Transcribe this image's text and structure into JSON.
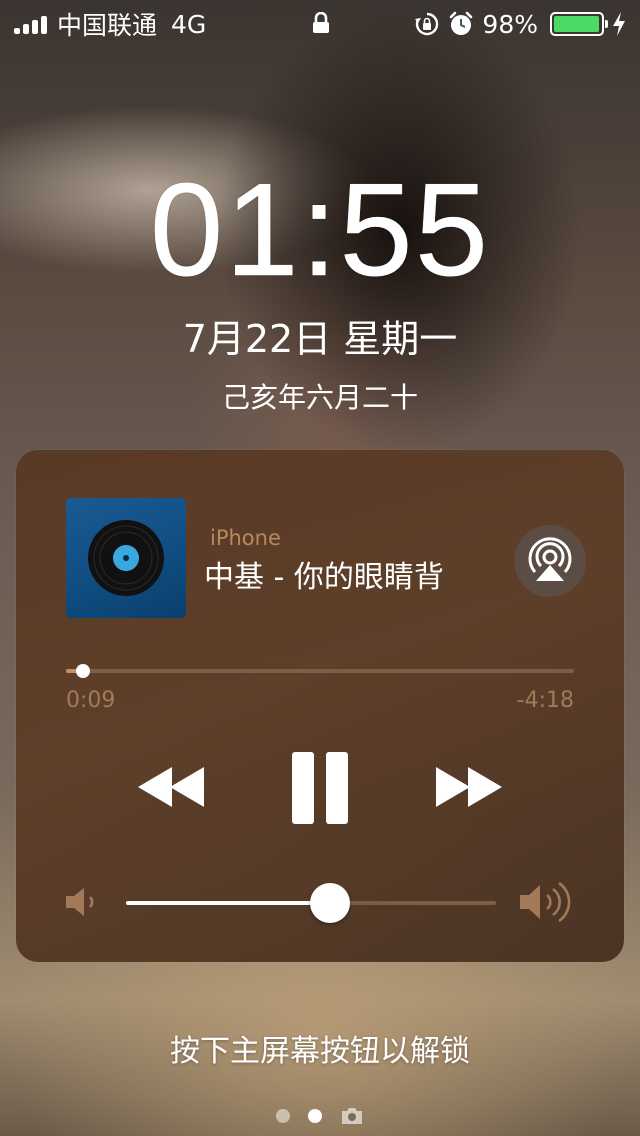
{
  "status_bar": {
    "carrier": "中国联通",
    "network": "4G",
    "battery_percent": "98%",
    "battery_level": 0.98,
    "icons": [
      "signal-icon",
      "lock-icon",
      "rotation-lock-icon",
      "alarm-icon",
      "battery-icon",
      "charging-icon"
    ]
  },
  "lock_screen": {
    "time": "01:55",
    "date": "7月22日 星期一",
    "lunar_date": "己亥年六月二十",
    "unlock_hint": "按下主屏幕按钮以解锁"
  },
  "now_playing": {
    "source": "iPhone",
    "title": "中基 - 你的眼睛背",
    "elapsed": "0:09",
    "remaining": "-4:18",
    "progress": 0.033,
    "volume": 0.55,
    "icons": [
      "album-art-vinyl-icon",
      "airplay-icon",
      "rewind-icon",
      "pause-icon",
      "fast-forward-icon",
      "volume-low-icon",
      "volume-high-icon"
    ]
  },
  "pager": {
    "page_count": 2,
    "active_page": 2,
    "icons": [
      "camera-icon"
    ]
  },
  "colors": {
    "accent_progress": "#c88f63",
    "secondary_text": "#a27a5a",
    "source_text": "#b9895e",
    "battery_green": "#4cd964",
    "album_blue": "#1a5a94"
  }
}
